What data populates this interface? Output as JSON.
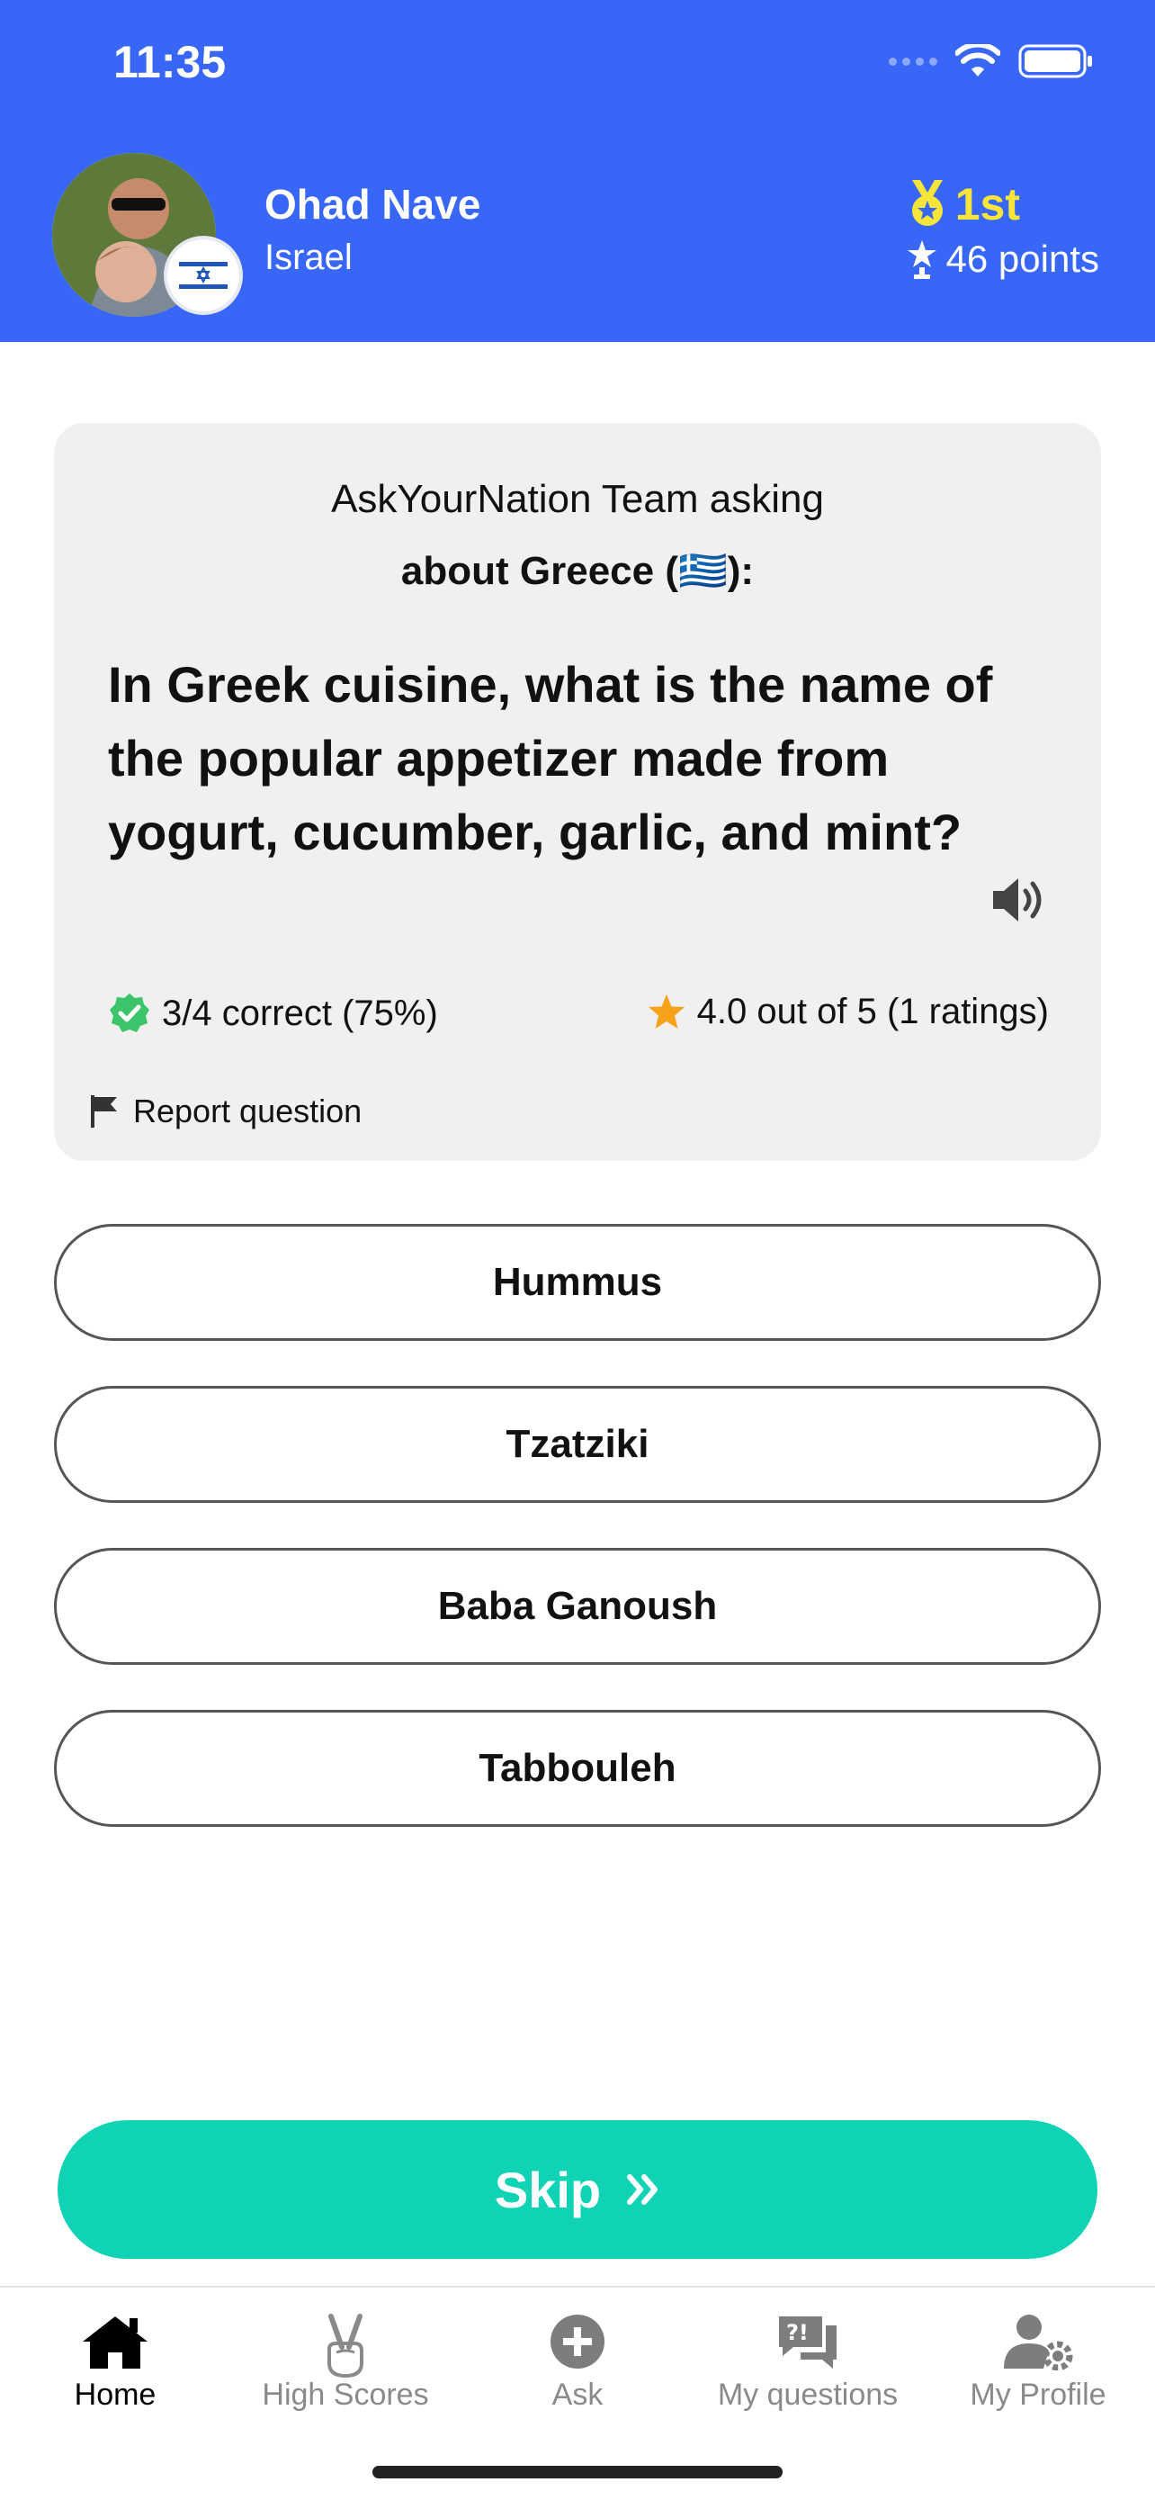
{
  "status_bar": {
    "time": "11:35"
  },
  "user": {
    "name": "Ohad Nave",
    "country": "Israel",
    "rank": "1st",
    "points": "46 points"
  },
  "question_card": {
    "asker": "AskYourNation Team asking",
    "about": "about Greece (🇬🇷):",
    "question": "In Greek cuisine, what is the name of the popular appetizer made from yogurt, cucumber, garlic, and mint?",
    "correct_stats": "3/4 correct (75%)",
    "rating": "4.0 out of 5 (1 ratings)",
    "report_label": "Report question"
  },
  "answers": [
    "Hummus",
    "Tzatziki",
    "Baba Ganoush",
    "Tabbouleh"
  ],
  "skip_label": "Skip",
  "tabs": [
    {
      "label": "Home",
      "icon": "home-icon"
    },
    {
      "label": "High Scores",
      "icon": "victory-hand-icon"
    },
    {
      "label": "Ask",
      "icon": "plus-circle-icon"
    },
    {
      "label": "My questions",
      "icon": "question-chat-icon"
    },
    {
      "label": "My Profile",
      "icon": "user-gear-icon"
    }
  ],
  "colors": {
    "header": "#3866f6",
    "rank": "#f8e53a",
    "skip": "#0fd3b4",
    "card": "#f0f0f0",
    "check": "#3cc46a",
    "star": "#f7a21b"
  }
}
